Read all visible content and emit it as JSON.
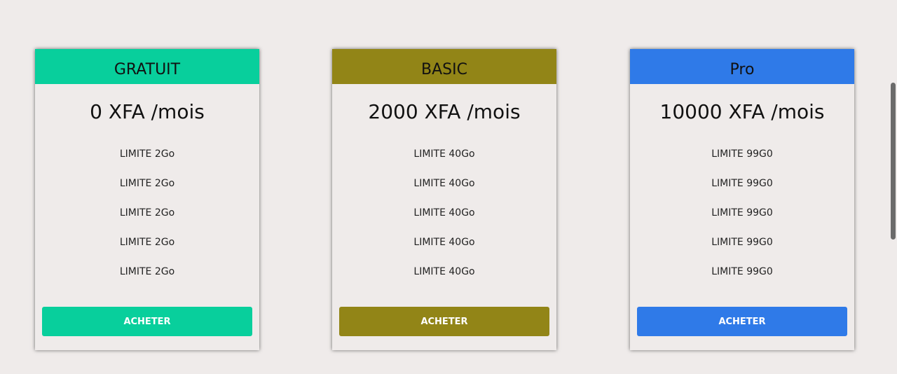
{
  "colors": {
    "background": "#efebea",
    "gratuit": "#08cf9c",
    "basic": "#928517",
    "pro": "#2f7ae8"
  },
  "plans": [
    {
      "name": "GRATUIT",
      "price": "0 XFA /mois",
      "features": [
        "LIMITE 2Go",
        "LIMITE 2Go",
        "LIMITE 2Go",
        "LIMITE 2Go",
        "LIMITE 2Go"
      ],
      "button_label": "ACHETER"
    },
    {
      "name": "BASIC",
      "price": "2000 XFA /mois",
      "features": [
        "LIMITE 40Go",
        "LIMITE 40Go",
        "LIMITE 40Go",
        "LIMITE 40Go",
        "LIMITE 40Go"
      ],
      "button_label": "ACHETER"
    },
    {
      "name": "Pro",
      "price": "10000 XFA /mois",
      "features": [
        "LIMITE 99G0",
        "LIMITE 99G0",
        "LIMITE 99G0",
        "LIMITE 99G0",
        "LIMITE 99G0"
      ],
      "button_label": "ACHETER"
    }
  ]
}
